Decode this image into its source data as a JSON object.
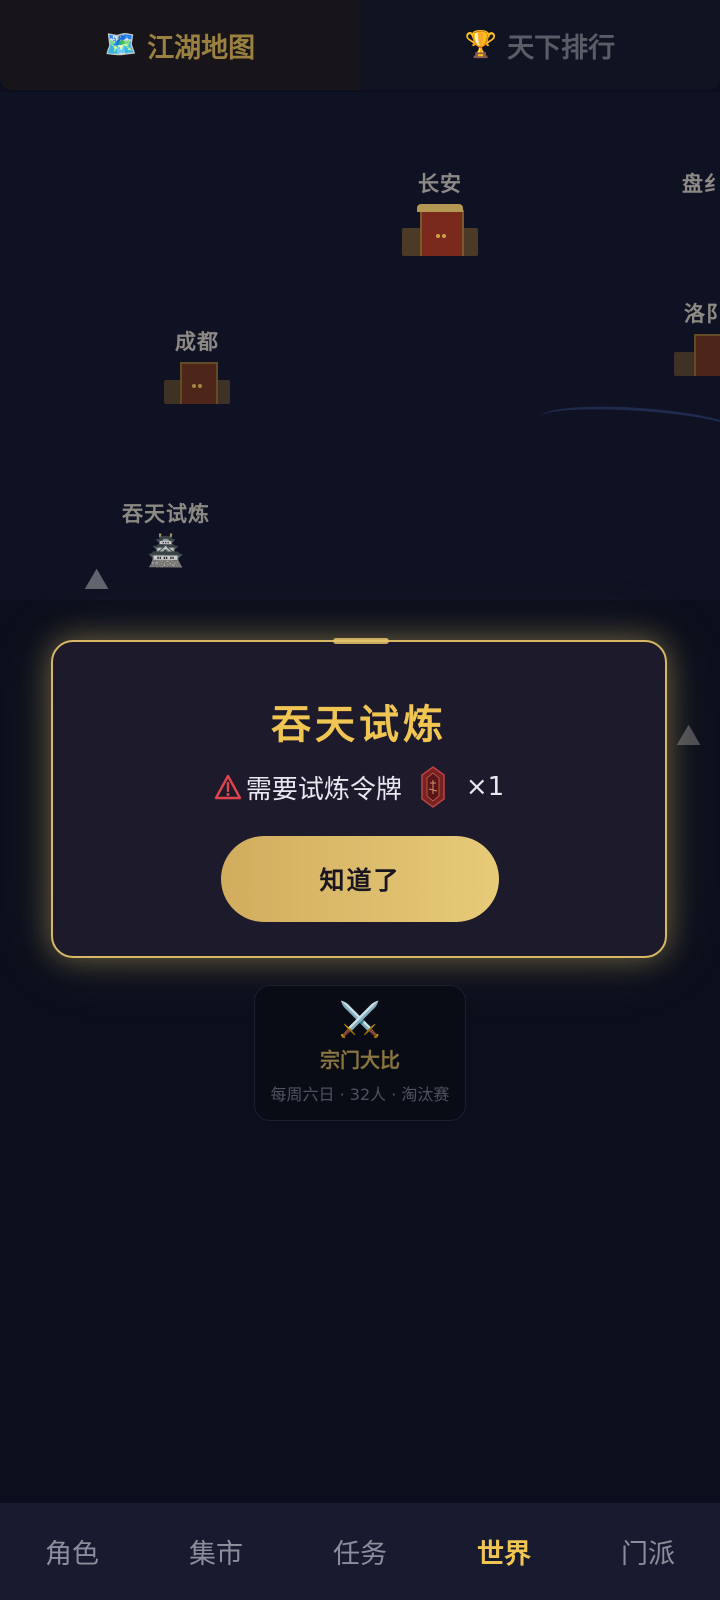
{
  "top_tabs": [
    {
      "label": "江湖地图",
      "icon": "🗺️",
      "icon_name": "map-icon",
      "active": true
    },
    {
      "label": "天下排行",
      "icon": "🏆",
      "icon_name": "trophy-icon",
      "active": false
    }
  ],
  "map": {
    "cities": {
      "changan": "长安",
      "panlong": "盘纟",
      "chengdu": "成都",
      "luoyang": "洛阝",
      "tuntian": "吞天试炼"
    },
    "trial_icon": "🏯"
  },
  "modal": {
    "title": "吞天试炼",
    "requirement_text": "需要试炼令牌",
    "requirement_count": "×1",
    "ok_label": "知道了"
  },
  "event_card": {
    "icon": "⚔️",
    "title": "宗门大比",
    "subtitle": "每周六日 · 32人 · 淘汰赛"
  },
  "bottom_nav": [
    {
      "label": "角色",
      "active": false
    },
    {
      "label": "集市",
      "active": false
    },
    {
      "label": "任务",
      "active": false
    },
    {
      "label": "世界",
      "active": true
    },
    {
      "label": "门派",
      "active": false
    }
  ],
  "colors": {
    "accent_gold": "#f0c552",
    "background": "#0b0f1d",
    "warning_red": "#e0454d"
  }
}
